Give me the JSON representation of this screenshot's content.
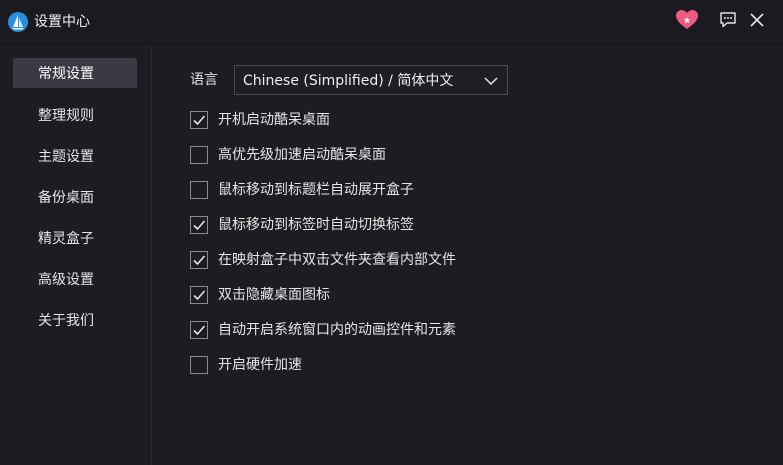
{
  "window": {
    "title": "设置中心",
    "logo_icon": "sail-logo-icon",
    "heart_icon": "heart-icon",
    "feedback_icon": "feedback-icon",
    "close_icon": "close-icon",
    "accent_color": "#f05a7e"
  },
  "sidebar": {
    "items": [
      {
        "label": "常规设置",
        "active": true
      },
      {
        "label": "整理规则",
        "active": false
      },
      {
        "label": "主题设置",
        "active": false
      },
      {
        "label": "备份桌面",
        "active": false
      },
      {
        "label": "精灵盒子",
        "active": false
      },
      {
        "label": "高级设置",
        "active": false
      },
      {
        "label": "关于我们",
        "active": false
      }
    ]
  },
  "general": {
    "language_label": "语言",
    "language_value": "Chinese (Simplified) / 简体中文",
    "options": [
      {
        "label": "开机启动酷呆桌面",
        "checked": true
      },
      {
        "label": "高优先级加速启动酷呆桌面",
        "checked": false
      },
      {
        "label": "鼠标移动到标题栏自动展开盒子",
        "checked": false
      },
      {
        "label": "鼠标移动到标签时自动切换标签",
        "checked": true
      },
      {
        "label": "在映射盒子中双击文件夹查看内部文件",
        "checked": true
      },
      {
        "label": "双击隐藏桌面图标",
        "checked": true
      },
      {
        "label": "自动开启系统窗口内的动画控件和元素",
        "checked": true
      },
      {
        "label": "开启硬件加速",
        "checked": false
      }
    ]
  }
}
